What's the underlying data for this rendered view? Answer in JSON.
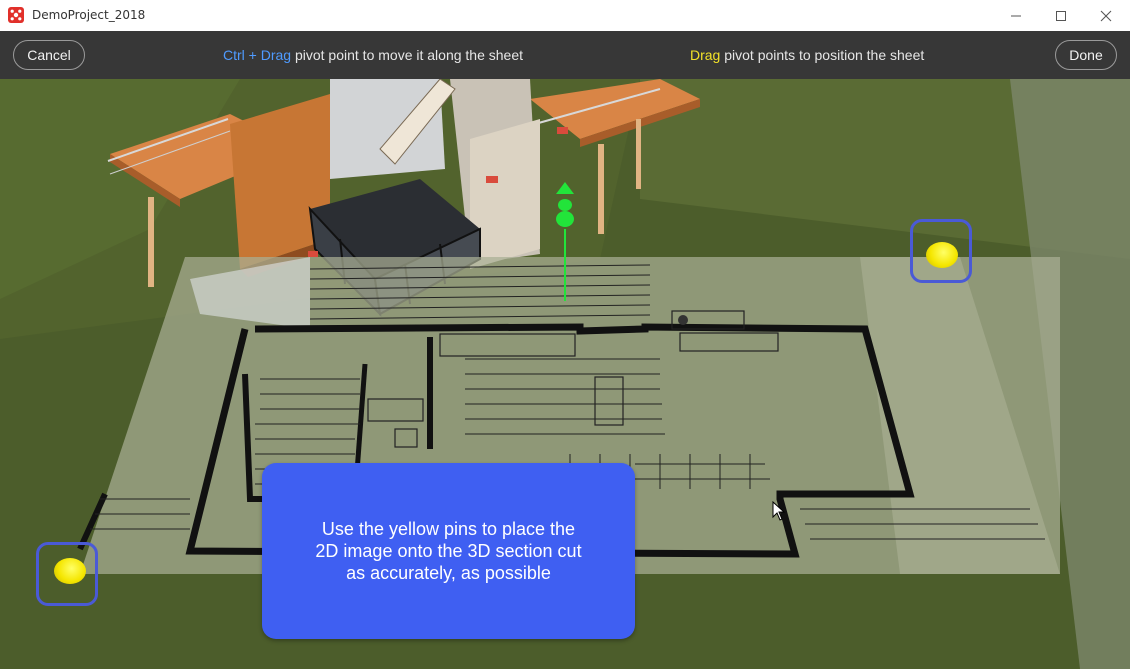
{
  "window": {
    "title": "DemoProject_2018"
  },
  "toolbar": {
    "cancel_label": "Cancel",
    "done_label": "Done",
    "hint_left_key": "Ctrl + Drag",
    "hint_left_text": " pivot point to move it along the sheet",
    "hint_right_key": "Drag",
    "hint_right_text": " pivot points to position the sheet"
  },
  "callout": {
    "line1": "Use the yellow pins to place the",
    "line2": "2D image onto the 3D section cut",
    "line3": "as accurately, as possible"
  },
  "colors": {
    "toolbar_bg": "#373737",
    "accent_blue": "#4f9bff",
    "accent_yellow": "#f2e229",
    "callout_bg": "#3f5ff2",
    "pin_yellow": "#f5e600",
    "pivot_green": "#22e43a"
  }
}
